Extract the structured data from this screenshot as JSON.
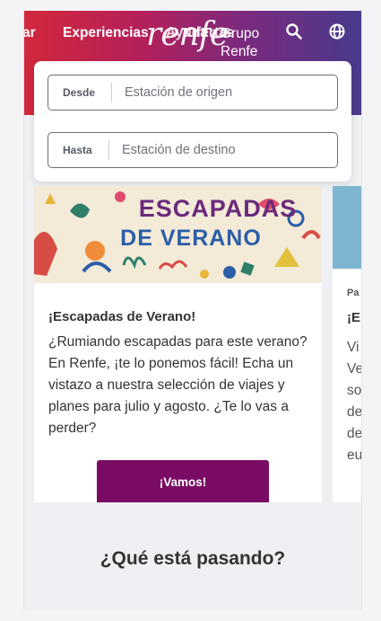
{
  "header": {
    "logo_text": "renfe",
    "nav": [
      "ar",
      "Experiencias",
      "Ayuda",
      "Ofertas",
      "Grupo Renfe"
    ],
    "grupo_lines": [
      "Grupo",
      "Renfe"
    ],
    "icons": [
      "search-icon",
      "globe-icon"
    ],
    "gradient": [
      "#d2283c",
      "#483a8c"
    ]
  },
  "search": {
    "from_label": "Desde",
    "from_placeholder": "Estación de origen",
    "to_label": "Hasta",
    "to_placeholder": "Estación de destino"
  },
  "cards": [
    {
      "image_text": [
        "ESCAPADAS",
        "DE VERANO"
      ],
      "title": "¡Escapadas de Verano!",
      "text": "¿Rumiando escapadas para este verano? En Renfe, ¡te lo ponemos fácil! Echa un vistazo a nuestra selección de viajes y planes para julio y agosto. ¿Te lo vas a perder?",
      "button": "¡Vamos!",
      "button_color": "#7a0c63"
    },
    {
      "tag": "Pa",
      "title": "¡E",
      "lines": [
        "Vi",
        "Ve",
        "so",
        "de",
        "de",
        "eu"
      ]
    }
  ],
  "section": {
    "title": "¿Qué está pasando?"
  }
}
